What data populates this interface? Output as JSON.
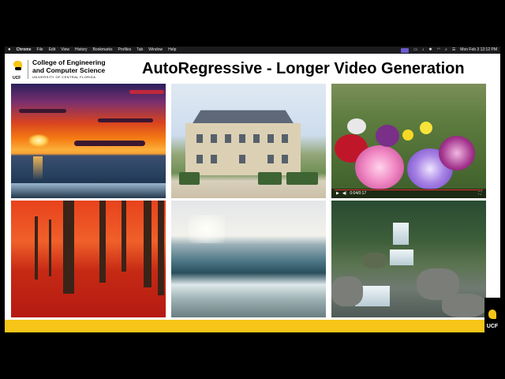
{
  "menubar": {
    "app": "Chrome",
    "menus": [
      "File",
      "Edit",
      "View",
      "History",
      "Bookmarks",
      "Profiles",
      "Tab",
      "Window",
      "Help"
    ],
    "clock": "Mon Feb 3  12:12 PM"
  },
  "slide": {
    "logo": {
      "line1": "College of Engineering",
      "line2": "and Computer Science",
      "university": "UNIVERSITY OF CENTRAL FLORIDA",
      "mark": "UCF"
    },
    "title": "AutoRegressive - Longer Video Generation",
    "video_player": {
      "time": "0:04/0:17"
    },
    "badge": "UCF"
  },
  "colors": {
    "accent": "#f5c518",
    "title_text": "#000000",
    "menubar_bg": "#1c1c1e"
  }
}
